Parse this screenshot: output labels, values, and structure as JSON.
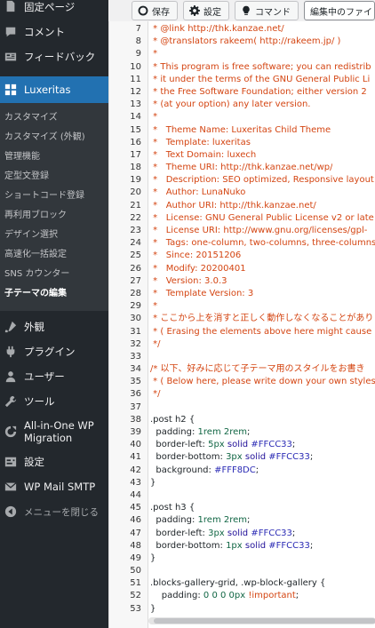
{
  "sidebar": {
    "top_items": [
      {
        "label": "固定ページ",
        "icon": "page-icon"
      },
      {
        "label": "コメント",
        "icon": "comment-icon"
      },
      {
        "label": "フィードバック",
        "icon": "feedback-icon"
      }
    ],
    "current": {
      "label": "Luxeritas",
      "icon": "luxeritas-icon"
    },
    "submenu": [
      {
        "label": "カスタマイズ"
      },
      {
        "label": "カスタマイズ (外観)"
      },
      {
        "label": "管理機能"
      },
      {
        "label": "定型文登録"
      },
      {
        "label": "ショートコード登録"
      },
      {
        "label": "再利用ブロック"
      },
      {
        "label": "デザイン選択"
      },
      {
        "label": "高速化一括設定"
      },
      {
        "label": "SNS カウンター"
      },
      {
        "label": "子テーマの編集",
        "active": true
      }
    ],
    "bottom_items": [
      {
        "label": "外観",
        "icon": "appearance-icon"
      },
      {
        "label": "プラグイン",
        "icon": "plugin-icon"
      },
      {
        "label": "ユーザー",
        "icon": "user-icon"
      },
      {
        "label": "ツール",
        "icon": "tool-icon"
      },
      {
        "label": "All-in-One WP Migration",
        "icon": "migration-icon"
      },
      {
        "label": "設定",
        "icon": "settings-icon"
      },
      {
        "label": "WP Mail SMTP",
        "icon": "mail-icon"
      },
      {
        "label": "メニューを閉じる",
        "icon": "collapse-icon"
      }
    ]
  },
  "toolbar": {
    "save_label": "保存",
    "settings_label": "設定",
    "command_label": "コマンド",
    "file_select_value": "編集中のファイ"
  },
  "editor": {
    "lines": [
      {
        "n": "7",
        "tokens": [
          {
            "t": " * @link http://thk.kanzae.net/",
            "c": "c-comment"
          }
        ]
      },
      {
        "n": "8",
        "tokens": [
          {
            "t": " * @translators rakeem( http://rakeem.jp/ )",
            "c": "c-comment"
          }
        ]
      },
      {
        "n": "9",
        "tokens": [
          {
            "t": " *",
            "c": "c-comment"
          }
        ]
      },
      {
        "n": "10",
        "tokens": [
          {
            "t": " * This program is free software; you can redistrib",
            "c": "c-comment"
          }
        ]
      },
      {
        "n": "11",
        "tokens": [
          {
            "t": " * it under the terms of the GNU General Public Li",
            "c": "c-comment"
          }
        ]
      },
      {
        "n": "12",
        "tokens": [
          {
            "t": " * the Free Software Foundation; either version 2",
            "c": "c-comment"
          }
        ]
      },
      {
        "n": "13",
        "tokens": [
          {
            "t": " * (at your option) any later version.",
            "c": "c-comment"
          }
        ]
      },
      {
        "n": "14",
        "tokens": [
          {
            "t": " *",
            "c": "c-comment"
          }
        ]
      },
      {
        "n": "15",
        "tokens": [
          {
            "t": " *   Theme Name: Luxeritas Child Theme",
            "c": "c-comment"
          }
        ]
      },
      {
        "n": "16",
        "tokens": [
          {
            "t": " *   Template: luxeritas",
            "c": "c-comment"
          }
        ]
      },
      {
        "n": "17",
        "tokens": [
          {
            "t": " *   Text Domain: luxech",
            "c": "c-comment"
          }
        ]
      },
      {
        "n": "18",
        "tokens": [
          {
            "t": " *   Theme URI: http://thk.kanzae.net/wp/",
            "c": "c-comment"
          }
        ]
      },
      {
        "n": "19",
        "tokens": [
          {
            "t": " *   Description: SEO optimized, Responsive layout",
            "c": "c-comment"
          }
        ]
      },
      {
        "n": "20",
        "tokens": [
          {
            "t": " *   Author: LunaNuko",
            "c": "c-comment"
          }
        ]
      },
      {
        "n": "21",
        "tokens": [
          {
            "t": " *   Author URI: http://thk.kanzae.net/",
            "c": "c-comment"
          }
        ]
      },
      {
        "n": "22",
        "tokens": [
          {
            "t": " *   License: GNU General Public License v2 or late",
            "c": "c-comment"
          }
        ]
      },
      {
        "n": "23",
        "tokens": [
          {
            "t": " *   License URI: http://www.gnu.org/licenses/gpl-",
            "c": "c-comment"
          }
        ]
      },
      {
        "n": "24",
        "tokens": [
          {
            "t": " *   Tags: one-column, two-columns, three-columns",
            "c": "c-comment"
          }
        ]
      },
      {
        "n": "25",
        "tokens": [
          {
            "t": " *   Since: 20151206",
            "c": "c-comment"
          }
        ]
      },
      {
        "n": "26",
        "tokens": [
          {
            "t": " *   Modify: 20200401",
            "c": "c-comment"
          }
        ]
      },
      {
        "n": "27",
        "tokens": [
          {
            "t": " *   Version: 3.0.3",
            "c": "c-comment"
          }
        ]
      },
      {
        "n": "28",
        "tokens": [
          {
            "t": " *   Template Version: 3",
            "c": "c-comment"
          }
        ]
      },
      {
        "n": "29",
        "tokens": [
          {
            "t": " *",
            "c": "c-comment"
          }
        ]
      },
      {
        "n": "30",
        "tokens": [
          {
            "t": " * ここから上を消すと正しく動作しなくなることがあり",
            "c": "c-comment"
          }
        ]
      },
      {
        "n": "31",
        "tokens": [
          {
            "t": " * ( Erasing the elements above here might cause",
            "c": "c-comment"
          }
        ]
      },
      {
        "n": "32",
        "tokens": [
          {
            "t": " */",
            "c": "c-comment"
          }
        ]
      },
      {
        "n": "33",
        "tokens": [
          {
            "t": "",
            "c": ""
          }
        ]
      },
      {
        "n": "34",
        "tokens": [
          {
            "t": "/* 以下、好みに応じて子テーマ用のスタイルをお書き",
            "c": "c-comment"
          }
        ]
      },
      {
        "n": "35",
        "tokens": [
          {
            "t": " * ( Below here, please write down your own styles",
            "c": "c-comment"
          }
        ]
      },
      {
        "n": "36",
        "tokens": [
          {
            "t": " */",
            "c": "c-comment"
          }
        ]
      },
      {
        "n": "37",
        "tokens": [
          {
            "t": "",
            "c": ""
          }
        ]
      },
      {
        "n": "38",
        "tokens": [
          {
            "t": ".post h2 {",
            "c": "c-sel"
          }
        ]
      },
      {
        "n": "39",
        "tokens": [
          {
            "t": "  padding: ",
            "c": "c-prop"
          },
          {
            "t": "1rem 2rem",
            "c": "c-num"
          },
          {
            "t": ";",
            "c": "c-prop"
          }
        ]
      },
      {
        "n": "40",
        "tokens": [
          {
            "t": "  border-left: ",
            "c": "c-prop"
          },
          {
            "t": "5px",
            "c": "c-num"
          },
          {
            "t": " solid ",
            "c": "c-kw"
          },
          {
            "t": "#FFCC33",
            "c": "c-hex"
          },
          {
            "t": ";",
            "c": "c-prop"
          }
        ]
      },
      {
        "n": "41",
        "tokens": [
          {
            "t": "  border-bottom: ",
            "c": "c-prop"
          },
          {
            "t": "3px",
            "c": "c-num"
          },
          {
            "t": " solid ",
            "c": "c-kw"
          },
          {
            "t": "#FFCC33",
            "c": "c-hex"
          },
          {
            "t": ";",
            "c": "c-prop"
          }
        ]
      },
      {
        "n": "42",
        "tokens": [
          {
            "t": "  background: ",
            "c": "c-prop"
          },
          {
            "t": "#FFF8DC",
            "c": "c-hex"
          },
          {
            "t": ";",
            "c": "c-prop"
          }
        ]
      },
      {
        "n": "43",
        "tokens": [
          {
            "t": "}",
            "c": "c-sel"
          }
        ]
      },
      {
        "n": "44",
        "tokens": [
          {
            "t": "",
            "c": ""
          }
        ]
      },
      {
        "n": "45",
        "tokens": [
          {
            "t": ".post h3 {",
            "c": "c-sel"
          }
        ]
      },
      {
        "n": "46",
        "tokens": [
          {
            "t": "  padding: ",
            "c": "c-prop"
          },
          {
            "t": "1rem 2rem",
            "c": "c-num"
          },
          {
            "t": ";",
            "c": "c-prop"
          }
        ]
      },
      {
        "n": "47",
        "tokens": [
          {
            "t": "  border-left: ",
            "c": "c-prop"
          },
          {
            "t": "3px",
            "c": "c-num"
          },
          {
            "t": " solid ",
            "c": "c-kw"
          },
          {
            "t": "#FFCC33",
            "c": "c-hex"
          },
          {
            "t": ";",
            "c": "c-prop"
          }
        ]
      },
      {
        "n": "48",
        "tokens": [
          {
            "t": "  border-bottom: ",
            "c": "c-prop"
          },
          {
            "t": "1px",
            "c": "c-num"
          },
          {
            "t": " solid ",
            "c": "c-kw"
          },
          {
            "t": "#FFCC33",
            "c": "c-hex"
          },
          {
            "t": ";",
            "c": "c-prop"
          }
        ]
      },
      {
        "n": "49",
        "tokens": [
          {
            "t": "}",
            "c": "c-sel"
          }
        ]
      },
      {
        "n": "50",
        "tokens": [
          {
            "t": "",
            "c": ""
          }
        ]
      },
      {
        "n": "51",
        "tokens": [
          {
            "t": ".blocks-gallery-grid, .wp-block-gallery {",
            "c": "c-sel"
          }
        ]
      },
      {
        "n": "52",
        "tokens": [
          {
            "t": "    padding: ",
            "c": "c-prop"
          },
          {
            "t": "0 0 0 0px",
            "c": "c-num"
          },
          {
            "t": " !important",
            "c": "c-imp"
          },
          {
            "t": ";",
            "c": "c-prop"
          }
        ]
      },
      {
        "n": "53",
        "tokens": [
          {
            "t": "}",
            "c": "c-sel"
          }
        ]
      }
    ]
  }
}
